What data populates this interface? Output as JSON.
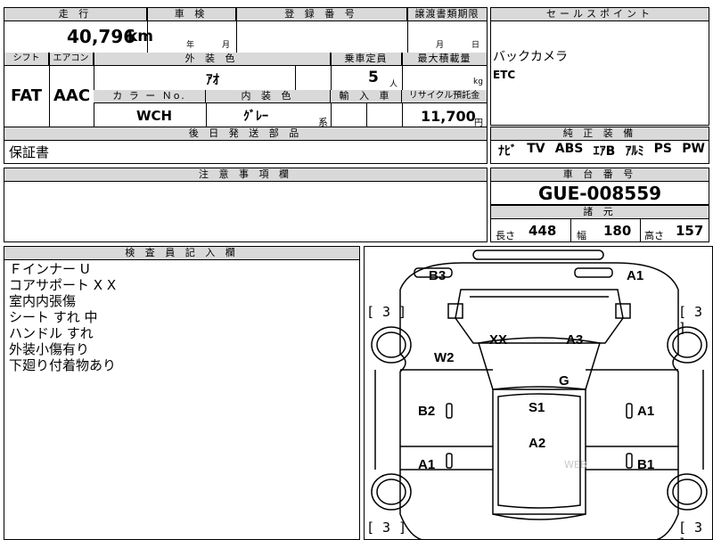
{
  "row1": {
    "mileage_label": "走 行",
    "mileage_value": "40,796",
    "mileage_unit": "km",
    "shaken_label": "車 検",
    "shaken_year_unit": "年",
    "shaken_month_unit": "月",
    "reg_label": "登 録 番 号",
    "transfer_label": "譲渡書類期限",
    "transfer_month_unit": "月",
    "transfer_day_unit": "日"
  },
  "row2": {
    "shift_label": "シフト",
    "shift_value": "FAT",
    "aircon_label": "エアコン",
    "aircon_value": "AAC",
    "exterior_label": "外 装 色",
    "exterior_value": "ｱｵ",
    "capacity_label": "乗車定員",
    "capacity_value": "5",
    "capacity_unit": "人",
    "load_label": "最大積載量",
    "load_unit": "kg",
    "color_no_label": "カ ラ ー Ｎo.",
    "color_no_value": "WCH",
    "interior_label": "内 装 色",
    "interior_value": "ｸﾞﾚｰ",
    "interior_suffix": "系",
    "import_label": "輸 入 車",
    "recycle_label": "リサイクル預託金",
    "recycle_value": "11,700",
    "recycle_unit": "円"
  },
  "delivery": {
    "label": "後 日 発 送 部 品",
    "value": "保証書"
  },
  "notes": {
    "label": "注 意 事 項 欄",
    "value": ""
  },
  "sales": {
    "label": "セールスポイント",
    "lines": [
      "バックカメラ",
      "ETC"
    ]
  },
  "equipment": {
    "label": "純 正 装 備",
    "items": [
      "ﾅﾋﾞ",
      "TV",
      "ABS",
      "ｴｱB",
      "ｱﾙﾐ",
      "PS",
      "PW"
    ]
  },
  "chassis": {
    "label": "車 台 番 号",
    "value": "GUE-008559"
  },
  "specs": {
    "label": "諸 元",
    "length_label": "長さ",
    "length_value": "448",
    "width_label": "幅",
    "width_value": "180",
    "height_label": "高さ",
    "height_value": "157"
  },
  "inspector": {
    "label": "検 査 員 記 入 欄",
    "lines": [
      "Ｆインナー U",
      "コアサポート X X",
      "室内内張傷",
      "シート すれ 中",
      "ハンドル すれ",
      "外装小傷有り",
      "下廻り付着物あり"
    ]
  },
  "diagram": {
    "labels": {
      "b3": "B3",
      "a1_top": "A1",
      "xx": "XX",
      "a3": "A3",
      "w2": "W2",
      "g": "G",
      "b2": "B2",
      "s1": "S1",
      "a1_right": "A1",
      "a2": "A2",
      "a1_left": "A1",
      "b1": "B1"
    },
    "tire_brackets": [
      "[ 3 ]",
      "[ 3 ]",
      "[ 3 ]",
      "[ 3 ]"
    ],
    "watermark": "WEB"
  }
}
